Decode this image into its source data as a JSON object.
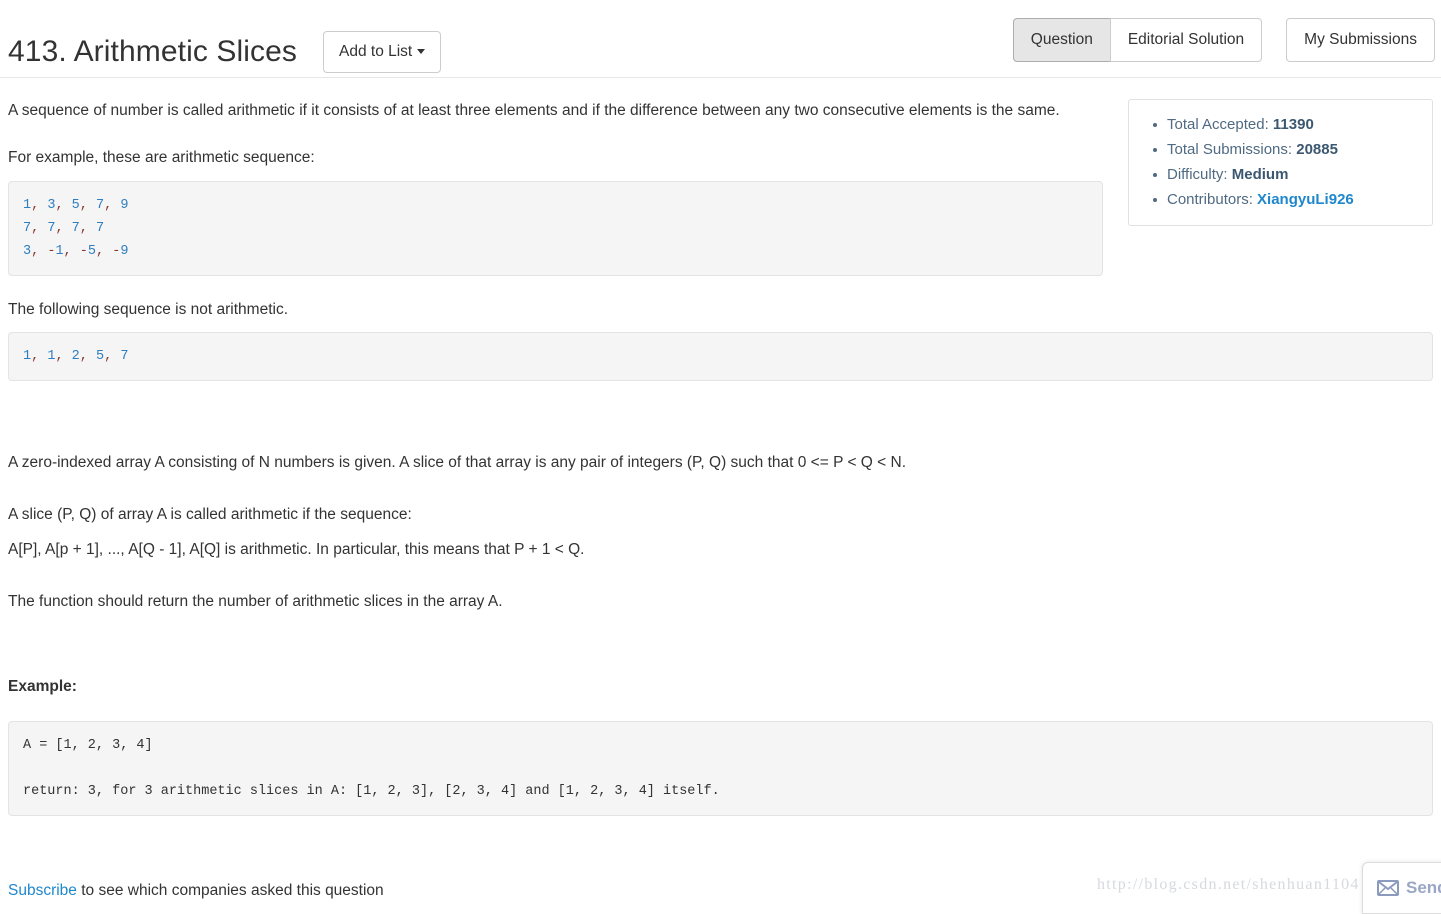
{
  "header": {
    "title": "413. Arithmetic Slices",
    "add_to_list_label": "Add to List",
    "tabs": [
      {
        "label": "Question",
        "active": true
      },
      {
        "label": "Editorial Solution",
        "active": false
      }
    ],
    "my_submissions_label": "My Submissions"
  },
  "question": {
    "paragraphs": {
      "intro": "A sequence of number is called arithmetic if it consists of at least three elements and if the difference between any two consecutive elements is the same.",
      "for_example": "For example, these are arithmetic sequence:",
      "not_arithmetic": "The following sequence is not arithmetic.",
      "zero_indexed": "A zero-indexed array A consisting of N numbers is given. A slice of that array is any pair of integers (P, Q) such that 0 <= P < Q < N.",
      "slice_called": "A slice (P, Q) of array A is called arithmetic if the sequence:",
      "slice_def": "A[P], A[p + 1], ..., A[Q - 1], A[Q] is arithmetic. In particular, this means that P + 1 < Q.",
      "function_return": "The function should return the number of arithmetic slices in the array A.",
      "example_label": "Example:"
    },
    "code_blocks": {
      "arithmetic_examples": [
        {
          "numbers": [
            "1",
            "3",
            "5",
            "7",
            "9"
          ]
        },
        {
          "numbers": [
            "7",
            "7",
            "7",
            "7"
          ]
        },
        {
          "numbers": [
            "3",
            "-1",
            "-5",
            "-9"
          ]
        }
      ],
      "arithmetic_examples_text": "1, 3, 5, 7, 9\n7, 7, 7, 7\n3, -1, -5, -9",
      "not_arithmetic_text": "1, 1, 2, 5, 7",
      "not_arithmetic_numbers": [
        "1",
        "1",
        "2",
        "5",
        "7"
      ],
      "example_line1": "A = [1, 2, 3, 4]",
      "example_line2": "return: 3, for 3 arithmetic slices in A: [1, 2, 3], [2, 3, 4] and [1, 2, 3, 4] itself."
    }
  },
  "stats": {
    "items": [
      {
        "label": "Total Accepted:",
        "value": "11390",
        "is_link": false
      },
      {
        "label": "Total Submissions:",
        "value": "20885",
        "is_link": false
      },
      {
        "label": "Difficulty:",
        "value": "Medium",
        "is_link": false
      },
      {
        "label": "Contributors:",
        "value": "XiangyuLi926",
        "is_link": true
      }
    ]
  },
  "footer": {
    "subscribe_label": "Subscribe",
    "subscribe_rest": " to see which companies asked this question",
    "watermark": "http://blog.csdn.net/shenhuan1104"
  },
  "chat_widget": {
    "label": "Send",
    "icon": "envelope-icon"
  },
  "colors": {
    "link": "#1f87cc",
    "stat_text": "#4f6a82",
    "code_bg": "#f5f5f5",
    "code_number": "#2d7ec0",
    "code_punct": "#8a3b2e",
    "tab_active_bg": "#e6e6e6",
    "watermark": "#d6d9de"
  }
}
